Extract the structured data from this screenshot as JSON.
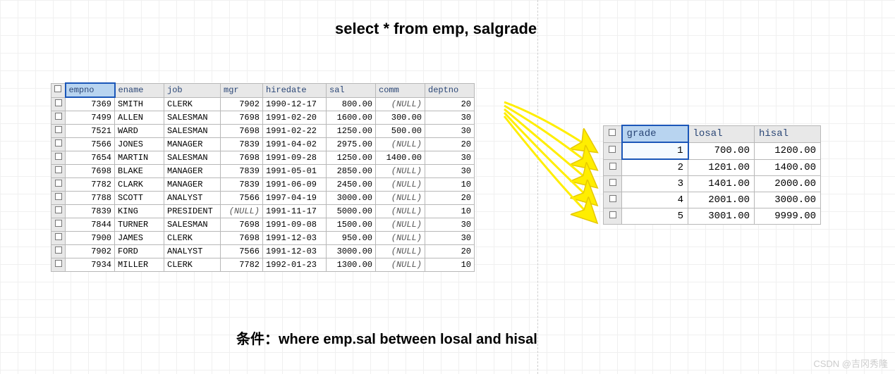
{
  "title": "select * from emp, salgrade",
  "condition": "条件：where emp.sal between losal and hisal",
  "watermark": "CSDN @吉冈秀隆",
  "emp": {
    "headers": [
      "empno",
      "ename",
      "job",
      "mgr",
      "hiredate",
      "sal",
      "comm",
      "deptno"
    ],
    "null_label": "(NULL)",
    "rows": [
      {
        "empno": "7369",
        "ename": "SMITH",
        "job": "CLERK",
        "mgr": "7902",
        "hiredate": "1990-12-17",
        "sal": "800.00",
        "comm": null,
        "deptno": "20"
      },
      {
        "empno": "7499",
        "ename": "ALLEN",
        "job": "SALESMAN",
        "mgr": "7698",
        "hiredate": "1991-02-20",
        "sal": "1600.00",
        "comm": "300.00",
        "deptno": "30"
      },
      {
        "empno": "7521",
        "ename": "WARD",
        "job": "SALESMAN",
        "mgr": "7698",
        "hiredate": "1991-02-22",
        "sal": "1250.00",
        "comm": "500.00",
        "deptno": "30"
      },
      {
        "empno": "7566",
        "ename": "JONES",
        "job": "MANAGER",
        "mgr": "7839",
        "hiredate": "1991-04-02",
        "sal": "2975.00",
        "comm": null,
        "deptno": "20"
      },
      {
        "empno": "7654",
        "ename": "MARTIN",
        "job": "SALESMAN",
        "mgr": "7698",
        "hiredate": "1991-09-28",
        "sal": "1250.00",
        "comm": "1400.00",
        "deptno": "30"
      },
      {
        "empno": "7698",
        "ename": "BLAKE",
        "job": "MANAGER",
        "mgr": "7839",
        "hiredate": "1991-05-01",
        "sal": "2850.00",
        "comm": null,
        "deptno": "30"
      },
      {
        "empno": "7782",
        "ename": "CLARK",
        "job": "MANAGER",
        "mgr": "7839",
        "hiredate": "1991-06-09",
        "sal": "2450.00",
        "comm": null,
        "deptno": "10"
      },
      {
        "empno": "7788",
        "ename": "SCOTT",
        "job": "ANALYST",
        "mgr": "7566",
        "hiredate": "1997-04-19",
        "sal": "3000.00",
        "comm": null,
        "deptno": "20"
      },
      {
        "empno": "7839",
        "ename": "KING",
        "job": "PRESIDENT",
        "mgr": null,
        "hiredate": "1991-11-17",
        "sal": "5000.00",
        "comm": null,
        "deptno": "10"
      },
      {
        "empno": "7844",
        "ename": "TURNER",
        "job": "SALESMAN",
        "mgr": "7698",
        "hiredate": "1991-09-08",
        "sal": "1500.00",
        "comm": null,
        "deptno": "30"
      },
      {
        "empno": "7900",
        "ename": "JAMES",
        "job": "CLERK",
        "mgr": "7698",
        "hiredate": "1991-12-03",
        "sal": "950.00",
        "comm": null,
        "deptno": "30"
      },
      {
        "empno": "7902",
        "ename": "FORD",
        "job": "ANALYST",
        "mgr": "7566",
        "hiredate": "1991-12-03",
        "sal": "3000.00",
        "comm": null,
        "deptno": "20"
      },
      {
        "empno": "7934",
        "ename": "MILLER",
        "job": "CLERK",
        "mgr": "7782",
        "hiredate": "1992-01-23",
        "sal": "1300.00",
        "comm": null,
        "deptno": "10"
      }
    ]
  },
  "salgrade": {
    "headers": [
      "grade",
      "losal",
      "hisal"
    ],
    "rows": [
      {
        "grade": "1",
        "losal": "700.00",
        "hisal": "1200.00"
      },
      {
        "grade": "2",
        "losal": "1201.00",
        "hisal": "1400.00"
      },
      {
        "grade": "3",
        "losal": "1401.00",
        "hisal": "2000.00"
      },
      {
        "grade": "4",
        "losal": "2001.00",
        "hisal": "3000.00"
      },
      {
        "grade": "5",
        "losal": "3001.00",
        "hisal": "9999.00"
      }
    ]
  }
}
